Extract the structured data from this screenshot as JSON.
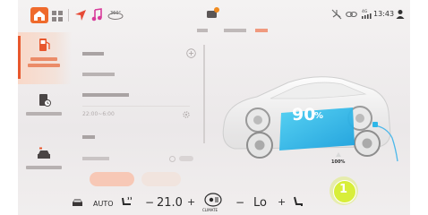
{
  "status": {
    "time": "13:43",
    "signal": "4G"
  },
  "sidebar": {
    "items": [
      {
        "name": "charging"
      },
      {
        "name": "schedule"
      },
      {
        "name": "vehicle"
      }
    ]
  },
  "battery": {
    "percent_label": "90",
    "percent_sign": "%",
    "charge_target": "100%"
  },
  "panel": {
    "time_range": "22:00~6:00"
  },
  "bottom": {
    "mode": "AUTO",
    "temp_left": "21.0",
    "minus": "−",
    "plus": "+",
    "climate_label": "CLIMATE",
    "temp_right": "Lo"
  },
  "marker": {
    "number": "1"
  },
  "colors": {
    "accent": "#e8572d",
    "battery": "#2fb7e8",
    "marker": "#d8ee3a"
  }
}
